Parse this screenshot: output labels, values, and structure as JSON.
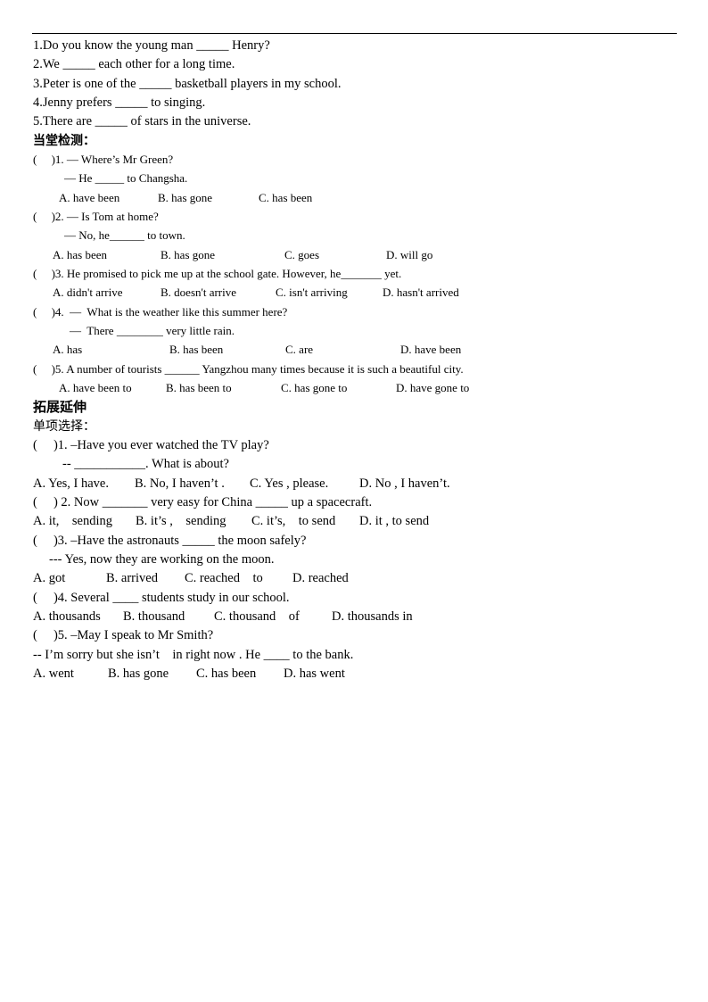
{
  "fill_in": [
    "1.Do you know the young man _____ Henry?",
    "2.We _____ each other for a long time.",
    "3.Peter is one of the _____ basketball players in my school.",
    "4.Jenny prefers _____ to singing.",
    "5.There are _____ of stars in the universe."
  ],
  "section1": {
    "heading": "当堂检测：",
    "questions": [
      {
        "stem": "(     )1. — Where’s Mr Green?",
        "answer_line": "— He _____ to Changsha.",
        "options": [
          "A. have been",
          "B. has gone",
          "C. has been"
        ]
      },
      {
        "stem": "(     )2. — Is Tom at home?",
        "answer_line": "— No, he______ to town.",
        "options": [
          "A. has been",
          "B. has gone",
          "C. goes",
          "D. will go"
        ]
      },
      {
        "stem": "(     )3. He promised to pick me up at the school gate. However, he_______ yet.",
        "options": [
          "A. didn't arrive",
          "B. doesn't arrive",
          "C. isn't arriving",
          "D. hasn't arrived"
        ]
      },
      {
        "stem": "(     )4.  —  What is the weather like this summer here?",
        "answer_line": "—  There ________ very little rain.",
        "options": [
          "A. has",
          "B. has been",
          "C. are",
          "D. have been"
        ]
      },
      {
        "stem": "(     )5. A number of tourists ______ Yangzhou many times because it is such a beautiful city.",
        "options": [
          "A. have been to",
          "B. has been to",
          "C. has gone to",
          "D. have gone to"
        ]
      }
    ]
  },
  "section2": {
    "heading": "拓展延伸",
    "subheading": "单项选择：",
    "questions": [
      {
        "stem": "(     )1. –Have you ever watched the TV play?",
        "answer_line": "-- ___________. What is about?",
        "options": [
          "A. Yes, I have.",
          "B. No, I haven’t .",
          "C. Yes , please.",
          "D. No , I haven’t."
        ]
      },
      {
        "stem": "(     ) 2. Now _______ very easy for China _____ up a spacecraft.",
        "options": [
          "A. it,    sending",
          "B. it’s ,    sending",
          "C. it’s,    to send",
          "D. it , to send"
        ]
      },
      {
        "stem": "(     )3. –Have the astronauts _____ the moon safely?",
        "answer_line": "--- Yes, now they are working on the moon.",
        "options": [
          "A. got",
          "B. arrived",
          "C. reached    to",
          "D. reached"
        ]
      },
      {
        "stem": "(     )4. Several ____ students study in our school.",
        "options": [
          "A. thousands",
          "B. thousand",
          "C. thousand    of",
          "D. thousands in"
        ]
      },
      {
        "stem": "(     )5. –May I speak to Mr Smith?",
        "answer_line": "-- I’m sorry but she isn’t    in right now . He ____ to the bank.",
        "options": [
          "A. went",
          "B. has gone",
          "C. has been",
          "D. has went"
        ]
      }
    ]
  }
}
